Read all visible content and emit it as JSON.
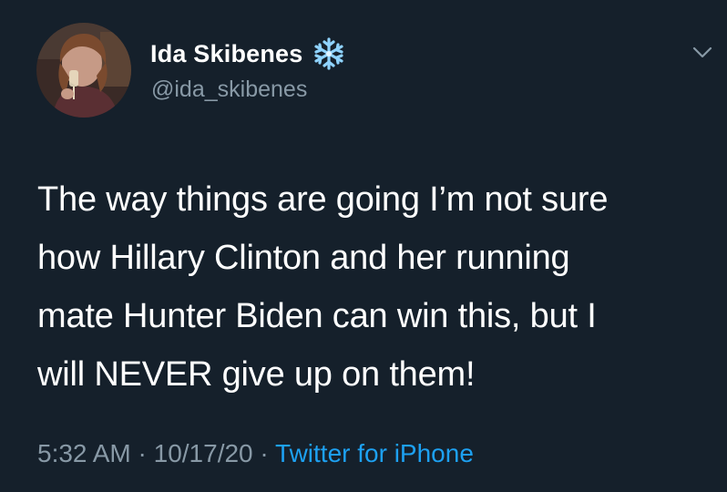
{
  "user": {
    "display_name": "Ida Skibenes",
    "handle": "@ida_skibenes",
    "badge_icon": "snowflake-icon",
    "avatar_icon": "profile-photo"
  },
  "tweet": {
    "lines": [
      "The way things are going I’m not sure",
      "how Hillary Clinton and her running",
      "mate Hunter Biden can win this, but I",
      "will NEVER give up on them!"
    ]
  },
  "meta": {
    "time": "5:32 AM",
    "separator": "·",
    "date": "10/17/20",
    "source": "Twitter for iPhone"
  },
  "colors": {
    "background": "#15202b",
    "text": "#ffffff",
    "muted": "#8899a6",
    "link": "#1da1f2"
  },
  "menu": {
    "icon": "chevron-down-icon"
  }
}
